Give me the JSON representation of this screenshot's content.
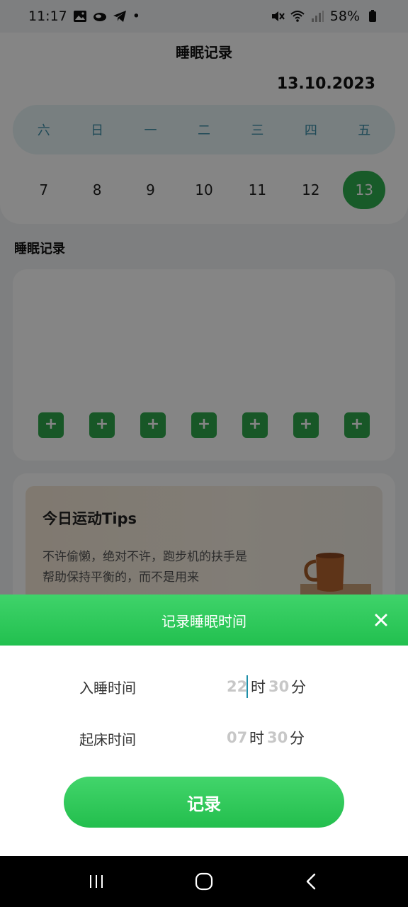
{
  "status_bar": {
    "time": "11:17",
    "dot": "•",
    "battery": "58%",
    "icons": [
      "gallery-icon",
      "cloud-icon",
      "telegram-icon",
      "mute-icon",
      "wifi-icon",
      "signal-icon",
      "battery-icon"
    ]
  },
  "page": {
    "title": "睡眠记录",
    "date": "13.10.2023",
    "weekdays": [
      "六",
      "日",
      "一",
      "二",
      "三",
      "四",
      "五"
    ],
    "days": [
      "7",
      "8",
      "9",
      "10",
      "11",
      "12",
      "13"
    ],
    "selected_day": "13",
    "section_title": "睡眠记录",
    "add_button_label": "+",
    "add_button_count": 7
  },
  "tips": {
    "title": "今日运动Tips",
    "body": "不许偷懒，绝对不许，跑步机的扶手是帮助保持平衡的，而不是用来"
  },
  "sheet": {
    "title": "记录睡眠时间",
    "close_icon": "close-icon",
    "sleep_label": "入睡时间",
    "sleep_hour": "22",
    "sleep_minute": "30",
    "wake_label": "起床时间",
    "wake_hour": "07",
    "wake_minute": "30",
    "hour_unit": "时",
    "minute_unit": "分",
    "record_button": "记录"
  },
  "colors": {
    "accent_green": "#2fae4f",
    "header_green": "#3fd36a",
    "weekday_blue": "#3d8fa8"
  },
  "nav": [
    "recents-icon",
    "home-icon",
    "back-icon"
  ]
}
